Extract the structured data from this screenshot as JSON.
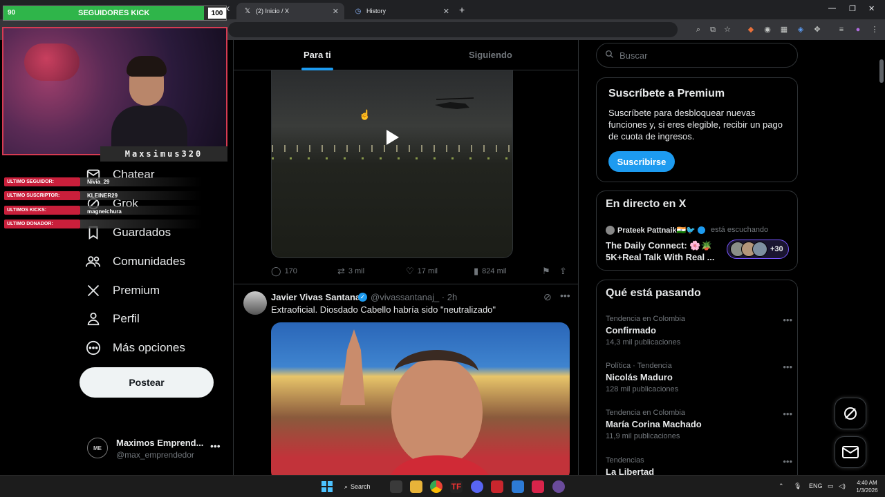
{
  "browser": {
    "active_tab_title": "(2) Inicio / X",
    "second_tab_title": "History",
    "partial_tab_x": "X"
  },
  "nav": {
    "items": [
      {
        "label": "Chatear",
        "icon": "message-icon"
      },
      {
        "label": "Grok",
        "icon": "grok-icon"
      },
      {
        "label": "Guardados",
        "icon": "bookmark-icon"
      },
      {
        "label": "Comunidades",
        "icon": "communities-icon"
      },
      {
        "label": "Premium",
        "icon": "x-logo-icon"
      },
      {
        "label": "Perfil",
        "icon": "profile-icon"
      },
      {
        "label": "Más opciones",
        "icon": "more-options-icon"
      }
    ],
    "post_button": "Postear",
    "account": {
      "name": "Maximos Emprend...",
      "handle": "@max_emprendedor",
      "avatar_text": "ME"
    }
  },
  "feed": {
    "tabs": {
      "for_you": "Para ti",
      "following": "Siguiendo"
    },
    "tweet1": {
      "replies": "170",
      "reposts": "3 mil",
      "likes": "17 mil",
      "views": "824 mil"
    },
    "tweet2": {
      "name": "Javier Vivas Santana",
      "handle": "@vivassantanaj_ · 2h",
      "text": "Extraoficial. Diosdado Cabello habría sido \"neutralizado\""
    }
  },
  "sidebar": {
    "search_placeholder": "Buscar",
    "premium": {
      "title": "Suscríbete a Premium",
      "description": "Suscríbete para desbloquear nuevas funciones y, si eres elegible, recibir un pago de cuota de ingresos.",
      "button": "Suscribirse"
    },
    "live": {
      "title": "En directo en X",
      "host": "Prateek Pattnaik🇮🇳🐦",
      "listening": "está escuchando",
      "room": "The Daily Connect: 🌸🪴 5K+Real Talk With Real ...",
      "count": "+30"
    },
    "trends": {
      "title": "Qué está pasando",
      "items": [
        {
          "context": "Tendencia en Colombia",
          "name": "Confirmado",
          "count": "14,3 mil publicaciones"
        },
        {
          "context": "Política · Tendencia",
          "name": "Nicolás Maduro",
          "count": "128 mil publicaciones"
        },
        {
          "context": "Tendencia en Colombia",
          "name": "María Corina Machado",
          "count": "11,9 mil publicaciones"
        },
        {
          "context": "Tendencias",
          "name": "La Libertad",
          "count": ""
        }
      ]
    }
  },
  "overlay": {
    "kick_current": "90",
    "kick_label": "SEGUIDORES KICK",
    "kick_goal": "100",
    "kick_progress": 0.9,
    "streamer": "Maxsimus320",
    "rows": [
      {
        "label": "ULTIMO SEGUIDOR:",
        "value": "Nivia_29"
      },
      {
        "label": "ULTIMO SUSCRIPTOR:",
        "value": "KLEINER29"
      },
      {
        "label": "ULTIMOS KICKS:",
        "value": "magneichura"
      },
      {
        "label": "ULTIMO DONADOR:",
        "value": ""
      }
    ]
  },
  "taskbar": {
    "search": "Search",
    "lang": "ENG",
    "time": "4:40 AM",
    "date": "1/3/2026"
  },
  "colors": {
    "accent": "#1d9bf0",
    "kick_green": "#2fb54a",
    "overlay_red": "#c91f3b"
  }
}
